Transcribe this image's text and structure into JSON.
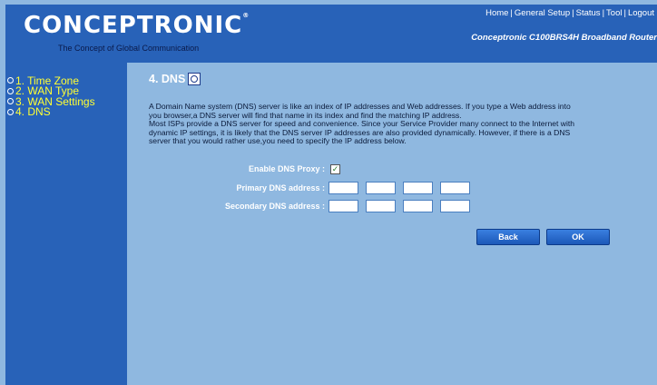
{
  "brand": {
    "logo": "CONCEPTRONIC",
    "registered": "®",
    "tagline": "The Concept of Global Communication",
    "product": "Conceptronic C100BRS4H Broadband Router"
  },
  "topnav": {
    "items": [
      "Home",
      "General Setup",
      "Status",
      "Tool",
      "Logout"
    ],
    "separator": "|"
  },
  "sidebar": {
    "items": [
      {
        "label": "1. Time Zone"
      },
      {
        "label": "2. WAN Type"
      },
      {
        "label": "3. WAN Settings"
      },
      {
        "label": "4. DNS"
      }
    ]
  },
  "main": {
    "title": "4. DNS",
    "description": [
      "A Domain Name system (DNS) server is like an index of IP addresses and Web addresses. If you type a Web address into",
      "you browser,a DNS server will find that name in its index and find the matching IP address.",
      "Most ISPs provide a DNS server for speed and convenience. Since your Service Provider many connect to the Internet with",
      "dynamic IP settings, it is likely that the DNS server IP addresses are also provided dynamically. However, if there is a DNS",
      "server that you would rather use,you need to specify the IP address below."
    ],
    "form": {
      "enable_dns_proxy_label": "Enable DNS Proxy :",
      "enable_dns_proxy_checked": true,
      "check_mark": "✓",
      "primary_label": "Primary DNS address :",
      "primary_values": [
        "",
        "",
        "",
        ""
      ],
      "secondary_label": "Secondary DNS address :",
      "secondary_values": [
        "",
        "",
        "",
        ""
      ]
    },
    "buttons": {
      "back": "Back",
      "ok": "OK"
    }
  }
}
